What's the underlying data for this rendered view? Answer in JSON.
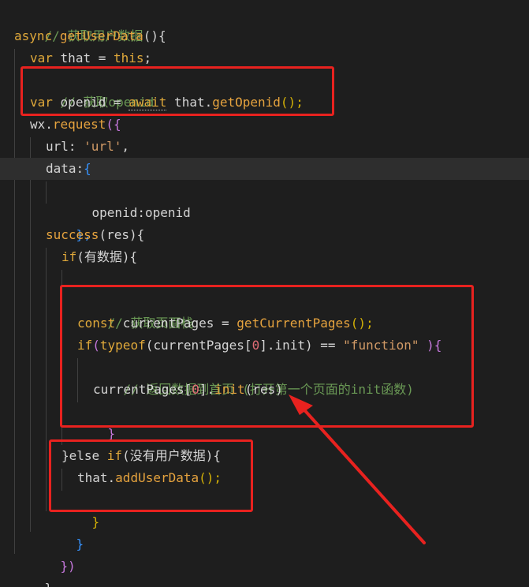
{
  "code": {
    "l1_comment": "// 获取用户数据",
    "l2_kw": "async",
    "l2_fn": "getUserData",
    "l2_rest": "(){",
    "l3_kw": "var",
    "l3_name": "that",
    "l3_eq": " = ",
    "l3_this": "this",
    "l3_end": ";",
    "l4_comment": "// 获取openid",
    "l5_kw": "var",
    "l5_name": "openid",
    "l5_eq": " = ",
    "l5_await": "await",
    "l5_obj": " that.",
    "l5_fn": "getOpenid",
    "l5_end": "();",
    "l6_obj": "wx.",
    "l6_fn": "request",
    "l6_open": "({",
    "l7_key": "url: ",
    "l7_str": "'url'",
    "l7_end": ",",
    "l8_key": "data:",
    "l8_open": "{",
    "l9_text": "openid:openid",
    "l10_close": "},",
    "l11_fn": "success",
    "l11_params": "(res){",
    "l12_kw": "if",
    "l12_cond": "(有数据){",
    "l14_comment": "// 获取页面栈",
    "l15_kw": "const",
    "l15_name": " currentPages = ",
    "l15_fn": "getCurrentPages",
    "l15_end": "();",
    "l16_kw": "if",
    "l16_open": "(",
    "l16_typeof": "typeof",
    "l16_a": "(currentPages[",
    "l16_num": "0",
    "l16_b": "].init) == ",
    "l16_str": "\"function\"",
    "l16_end": " ){",
    "l17_comment": "// 返回数据到首页 (打开第一个页面的init函数)",
    "l18_a": "currentPages[",
    "l18_num": "0",
    "l18_b": "].",
    "l18_fn": "init",
    "l18_end": "(res)",
    "l19_close": "}",
    "l21_a": "}else ",
    "l21_kw": "if",
    "l21_cond": "(没有用户数据){",
    "l22_obj": "that.",
    "l22_fn": "addUserData",
    "l22_end": "();",
    "l23_close": "}",
    "l24_close": "}",
    "l25_close": "})",
    "l26_close": "},"
  },
  "colors": {
    "background": "#1e1e1e",
    "highlight_line": "#2e2e2e",
    "annotation_box": "#e8221f",
    "comment": "#6a9955",
    "keyword": "#e0a93a"
  }
}
